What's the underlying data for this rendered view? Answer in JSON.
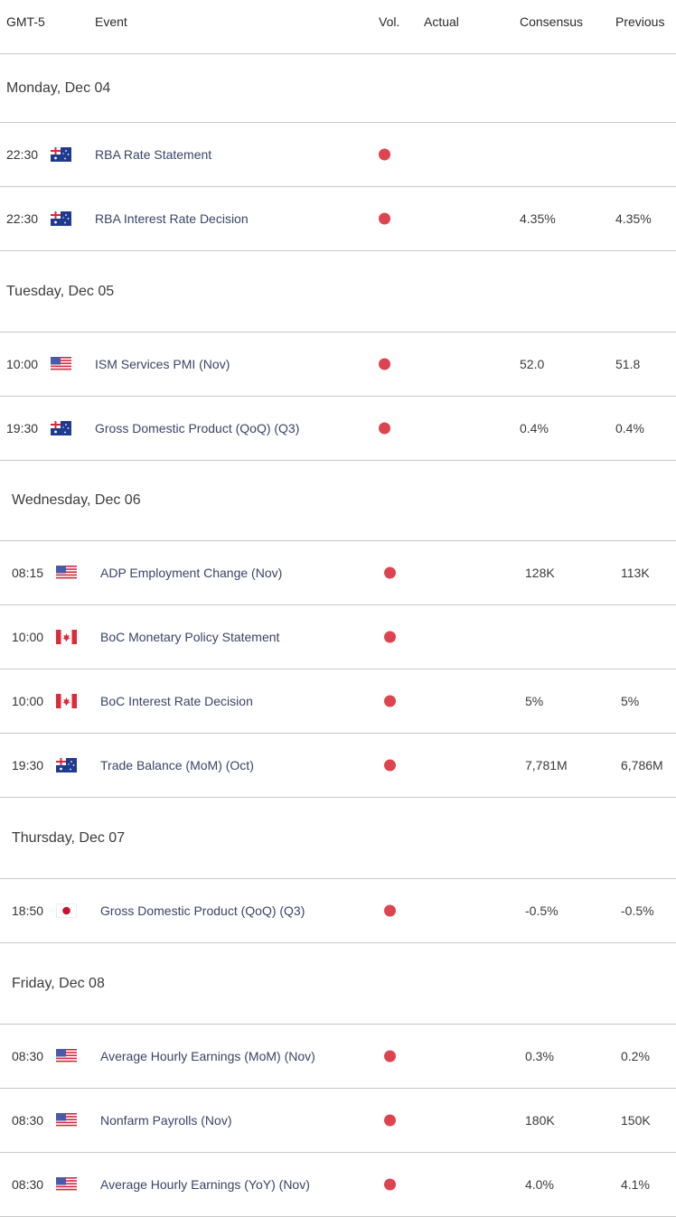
{
  "header": {
    "timezone": "GMT-5",
    "event": "Event",
    "vol": "Vol.",
    "actual": "Actual",
    "consensus": "Consensus",
    "previous": "Previous"
  },
  "colors": {
    "volatility_high": "#dd4450"
  },
  "days": [
    {
      "label": "Monday, Dec 04",
      "events": [
        {
          "time": "22:30",
          "country": "AU",
          "flag_icon": "australia-flag-icon",
          "event": "RBA Rate Statement",
          "volatility": "high",
          "actual": "",
          "consensus": "",
          "previous": ""
        },
        {
          "time": "22:30",
          "country": "AU",
          "flag_icon": "australia-flag-icon",
          "event": "RBA Interest Rate Decision",
          "volatility": "high",
          "actual": "",
          "consensus": "4.35%",
          "previous": "4.35%"
        }
      ]
    },
    {
      "label": "Tuesday, Dec 05",
      "events": [
        {
          "time": "10:00",
          "country": "US",
          "flag_icon": "usa-flag-icon",
          "event": "ISM Services PMI (Nov)",
          "volatility": "high",
          "actual": "",
          "consensus": "52.0",
          "previous": "51.8"
        },
        {
          "time": "19:30",
          "country": "AU",
          "flag_icon": "australia-flag-icon",
          "event": "Gross Domestic Product (QoQ) (Q3)",
          "volatility": "high",
          "actual": "",
          "consensus": "0.4%",
          "previous": "0.4%"
        }
      ]
    },
    {
      "label": "Wednesday, Dec 06",
      "events": [
        {
          "time": "08:15",
          "country": "US",
          "flag_icon": "usa-flag-icon",
          "event": "ADP Employment Change (Nov)",
          "volatility": "high",
          "actual": "",
          "consensus": "128K",
          "previous": "113K"
        },
        {
          "time": "10:00",
          "country": "CA",
          "flag_icon": "canada-flag-icon",
          "event": "BoC Monetary Policy Statement",
          "volatility": "high",
          "actual": "",
          "consensus": "",
          "previous": ""
        },
        {
          "time": "10:00",
          "country": "CA",
          "flag_icon": "canada-flag-icon",
          "event": "BoC Interest Rate Decision",
          "volatility": "high",
          "actual": "",
          "consensus": "5%",
          "previous": "5%"
        },
        {
          "time": "19:30",
          "country": "AU",
          "flag_icon": "australia-flag-icon",
          "event": "Trade Balance (MoM) (Oct)",
          "volatility": "high",
          "actual": "",
          "consensus": "7,781M",
          "previous": "6,786M"
        }
      ]
    },
    {
      "label": "Thursday, Dec 07",
      "events": [
        {
          "time": "18:50",
          "country": "JP",
          "flag_icon": "japan-flag-icon",
          "event": "Gross Domestic Product (QoQ) (Q3)",
          "volatility": "high",
          "actual": "",
          "consensus": "-0.5%",
          "previous": "-0.5%"
        }
      ]
    },
    {
      "label": "Friday, Dec 08",
      "events": [
        {
          "time": "08:30",
          "country": "US",
          "flag_icon": "usa-flag-icon",
          "event": "Average Hourly Earnings (MoM) (Nov)",
          "volatility": "high",
          "actual": "",
          "consensus": "0.3%",
          "previous": "0.2%"
        },
        {
          "time": "08:30",
          "country": "US",
          "flag_icon": "usa-flag-icon",
          "event": "Nonfarm Payrolls (Nov)",
          "volatility": "high",
          "actual": "",
          "consensus": "180K",
          "previous": "150K"
        },
        {
          "time": "08:30",
          "country": "US",
          "flag_icon": "usa-flag-icon",
          "event": "Average Hourly Earnings (YoY) (Nov)",
          "volatility": "high",
          "actual": "",
          "consensus": "4.0%",
          "previous": "4.1%"
        }
      ]
    }
  ]
}
